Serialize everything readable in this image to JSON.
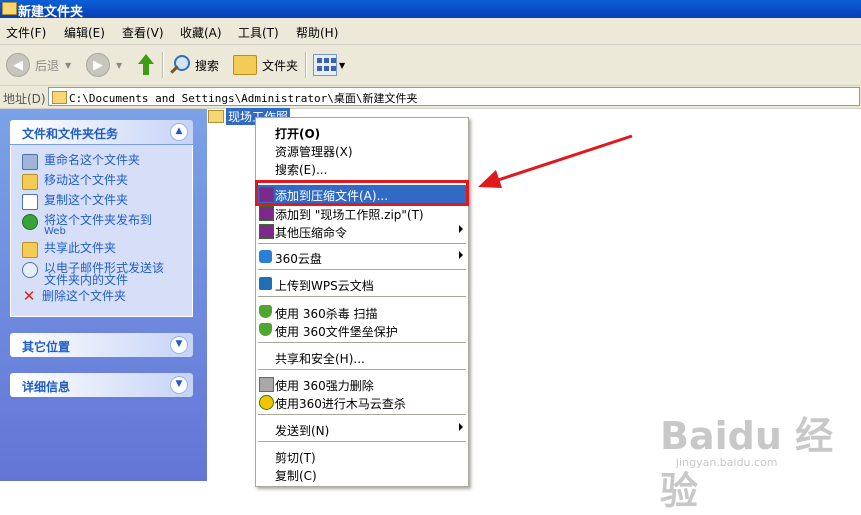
{
  "window": {
    "title": "新建文件夹"
  },
  "menubar": [
    {
      "label": "文件(F)"
    },
    {
      "label": "编辑(E)"
    },
    {
      "label": "查看(V)"
    },
    {
      "label": "收藏(A)"
    },
    {
      "label": "工具(T)"
    },
    {
      "label": "帮助(H)"
    }
  ],
  "toolbar": {
    "back": "后退",
    "search": "搜索",
    "folders": "文件夹"
  },
  "address": {
    "label": "地址(D)",
    "path": "C:\\Documents and Settings\\Administrator\\桌面\\新建文件夹"
  },
  "tasks_panel": {
    "title": "文件和文件夹任务",
    "items": [
      {
        "label": "重命名这个文件夹"
      },
      {
        "label": "移动这个文件夹"
      },
      {
        "label": "复制这个文件夹"
      },
      {
        "label_line1": "将这个文件夹发布到",
        "label_line2": "Web"
      },
      {
        "label": "共享此文件夹"
      },
      {
        "label_line1": "以电子邮件形式发送该",
        "label_line2": "文件夹内的文件"
      },
      {
        "label": "删除这个文件夹"
      }
    ]
  },
  "other_places": {
    "title": "其它位置"
  },
  "details": {
    "title": "详细信息"
  },
  "file": {
    "name": "现场工作照"
  },
  "context_menu": {
    "items": [
      {
        "label": "打开(O)"
      },
      {
        "label": "资源管理器(X)"
      },
      {
        "label": "搜索(E)..."
      },
      {
        "label": "添加到压缩文件(A)..."
      },
      {
        "label": "添加到 \"现场工作照.zip\"(T)"
      },
      {
        "label": "其他压缩命令"
      },
      {
        "label": "360云盘"
      },
      {
        "label": "上传到WPS云文档"
      },
      {
        "label": "使用 360杀毒 扫描"
      },
      {
        "label": "使用 360文件堡垒保护"
      },
      {
        "label": "共享和安全(H)..."
      },
      {
        "label": "使用 360强力删除"
      },
      {
        "label": "使用360进行木马云查杀"
      },
      {
        "label": "发送到(N)"
      },
      {
        "label": "剪切(T)"
      },
      {
        "label": "复制(C)"
      }
    ],
    "highlighted_index": 3
  },
  "watermark": {
    "brand": "Baidu 经验",
    "url": "jingyan.baidu.com"
  },
  "colors": {
    "highlight": "#316ac5",
    "annotation": "#e1191c",
    "title_bar": "#0a49c5"
  }
}
